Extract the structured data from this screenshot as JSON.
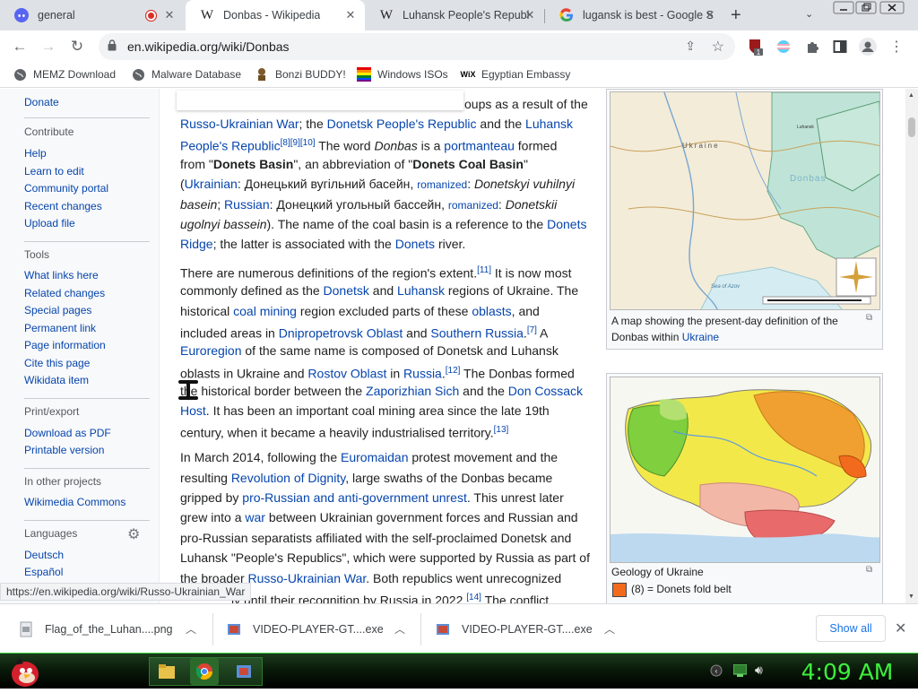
{
  "tabs": [
    {
      "title": "general",
      "favicon": "discord-icon",
      "playing": true
    },
    {
      "title": "Donbas - Wikipedia",
      "favicon": "wikipedia-icon",
      "active": true
    },
    {
      "title": "Luhansk People's Republ",
      "favicon": "wikipedia-icon"
    },
    {
      "title": "lugansk is best - Google S",
      "favicon": "google-icon"
    }
  ],
  "toolbar": {
    "url": "en.wikipedia.org/wiki/Donbas",
    "extension_badge": "1"
  },
  "bookmarks": [
    {
      "label": "MEMZ Download",
      "icon": "globe-icon"
    },
    {
      "label": "Malware Database",
      "icon": "globe-icon"
    },
    {
      "label": "Bonzi BUDDY!",
      "icon": "bonzi-icon"
    },
    {
      "label": "Windows ISOs",
      "icon": "windows-icon"
    },
    {
      "label": "Egyptian Embassy",
      "icon": "wix-icon"
    }
  ],
  "sidebar": {
    "donate": "Donate",
    "contribute_heading": "Contribute",
    "contribute": [
      "Help",
      "Learn to edit",
      "Community portal",
      "Recent changes",
      "Upload file"
    ],
    "tools_heading": "Tools",
    "tools": [
      "What links here",
      "Related changes",
      "Special pages",
      "Permanent link",
      "Page information",
      "Cite this page",
      "Wikidata item"
    ],
    "print_heading": "Print/export",
    "print": [
      "Download as PDF",
      "Printable version"
    ],
    "projects_heading": "In other projects",
    "projects": [
      "Wikimedia Commons"
    ],
    "languages_heading": "Languages",
    "languages": [
      "Deutsch",
      "Español"
    ]
  },
  "article": {
    "p1_l1": "oups as a result of the",
    "p1_l2_a": "Russo-Ukrainian War",
    "p1_l2_b": "; the ",
    "p1_l2_c": "Donetsk People's Republic",
    "p1_l2_d": " and the ",
    "p1_l2_e": "Luhansk",
    "p1_l3_a": "People's Republic",
    "p1_l3_sup": "[8][9][10]",
    "p1_l3_b": " The word ",
    "p1_l3_c": "Donbas",
    "p1_l3_d": " is a ",
    "p1_l3_e": "portmanteau",
    "p1_l3_f": " formed",
    "p1_l4_a": "from \"",
    "p1_l4_b": "Donets Basin",
    "p1_l4_c": "\", an abbreviation of \"",
    "p1_l4_d": "Donets Coal Basin",
    "p1_l4_e": "\"",
    "p1_l5_a": "(",
    "p1_l5_b": "Ukrainian",
    "p1_l5_c": ": Донецький вугільний басейн, ",
    "p1_l5_d": "romanized",
    "p1_l5_e": ": ",
    "p1_l5_f": "Donetskyi vuhilnyi",
    "p1_l6_a": "basein",
    "p1_l6_b": "; ",
    "p1_l6_c": "Russian",
    "p1_l6_d": ": Донецкий угольный бассейн, ",
    "p1_l6_e": "romanized",
    "p1_l6_f": ": ",
    "p1_l6_g": "Donetskii",
    "p1_l7_a": "ugolnyi bassein",
    "p1_l7_b": "). The name of the coal basin is a reference to the ",
    "p1_l7_c": "Donets",
    "p1_l8_a": "Ridge",
    "p1_l8_b": "; the latter is associated with the ",
    "p1_l8_c": "Donets",
    "p1_l8_d": " river.",
    "p2_l1_a": "There are numerous definitions of the region's extent.",
    "p2_l1_sup": "[11]",
    "p2_l1_b": " It is now most",
    "p2_l2_a": "commonly defined as the ",
    "p2_l2_b": "Donetsk",
    "p2_l2_c": " and ",
    "p2_l2_d": "Luhansk",
    "p2_l2_e": " regions of Ukraine. The",
    "p2_l3_a": "historical ",
    "p2_l3_b": "coal mining",
    "p2_l3_c": " region excluded parts of these ",
    "p2_l3_d": "oblasts",
    "p2_l3_e": ", and",
    "p2_l4_a": "included areas in ",
    "p2_l4_b": "Dnipropetrovsk Oblast",
    "p2_l4_c": " and ",
    "p2_l4_d": "Southern Russia",
    "p2_l4_e": ".",
    "p2_l4_sup": "[7]",
    "p2_l4_f": " A",
    "p2_l5_a": "Euroregion",
    "p2_l5_b": " of the same name is composed of Donetsk and Luhansk",
    "p2_l6_a": "oblasts in Ukraine and ",
    "p2_l6_b": "Rostov Oblast",
    "p2_l6_c": " in ",
    "p2_l6_d": "Russia",
    "p2_l6_e": ".",
    "p2_l6_sup": "[12]",
    "p2_l6_f": " The Donbas formed",
    "p2_l7_a": "the historical border between the ",
    "p2_l7_b": "Zaporizhian Sich",
    "p2_l7_c": " and the ",
    "p2_l7_d": "Don Cossack",
    "p2_l8_a": "Host",
    "p2_l8_b": ". It has been an important coal mining area since the late 19th",
    "p2_l9_a": "century, when it became a heavily industrialised territory.",
    "p2_l9_sup": "[13]",
    "p3_l1_a": "In March 2014, following the ",
    "p3_l1_b": "Euromaidan",
    "p3_l1_c": " protest movement and the",
    "p3_l2_a": "resulting ",
    "p3_l2_b": "Revolution of Dignity",
    "p3_l2_c": ", large swaths of the Donbas became",
    "p3_l3_a": "gripped by ",
    "p3_l3_b": "pro-Russian and anti-government unrest",
    "p3_l3_c": ". This unrest later",
    "p3_l4_a": "grew into a ",
    "p3_l4_b": "war",
    "p3_l4_c": " between Ukrainian government forces and Russian and",
    "p3_l5": "pro-Russian separatists affiliated with the self-proclaimed Donetsk and",
    "p3_l6": "Luhansk \"People's Republics\", which were supported by Russia as part of",
    "p3_l7_a": "the broader ",
    "p3_l7_b": "Russo-Ukrainian War",
    "p3_l7_c": ". Both republics went unrecognized",
    "p3_l8_a": "ly until their recognition by Russia in 2022.",
    "p3_l8_sup": "[14]",
    "p3_l8_b": " The conflict"
  },
  "figure1": {
    "caption_a": "A map showing the present-day definition of the",
    "caption_b": "Donbas within ",
    "caption_link": "Ukraine",
    "map_labels": {
      "ukraine": "Ukraine",
      "donbas": "Donbas",
      "luhansk": "Luhansk",
      "sea": "Sea of Azov"
    }
  },
  "figure2": {
    "caption": "Geology of Ukraine",
    "legend": "(8) = Donets fold belt",
    "legend_color": "#f26b1d"
  },
  "status_url": "https://en.wikipedia.org/wiki/Russo-Ukrainian_War",
  "downloads": [
    {
      "name": "Flag_of_the_Luhan....png"
    },
    {
      "name": "VIDEO-PLAYER-GT....exe"
    },
    {
      "name": "VIDEO-PLAYER-GT....exe"
    }
  ],
  "download_show_all": "Show all",
  "taskbar": {
    "clock": "4:09 AM"
  }
}
